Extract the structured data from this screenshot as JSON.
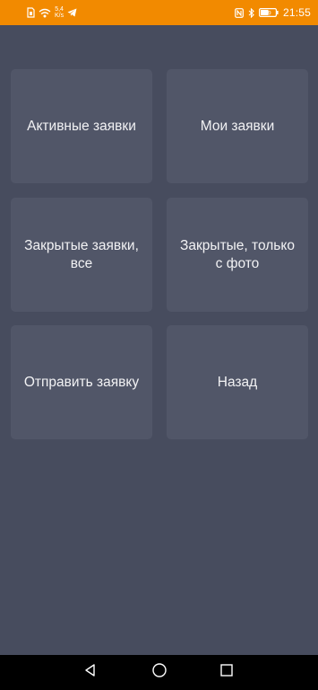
{
  "status_bar": {
    "speed_value": "5,4",
    "speed_unit": "K/s",
    "time": "21:55",
    "battery_level": "49",
    "icons": [
      "sim-card-icon",
      "wifi-icon",
      "telegram-icon",
      "nfc-icon",
      "bluetooth-icon",
      "battery-icon"
    ]
  },
  "menu": {
    "tiles": [
      {
        "label": "Активные заявки"
      },
      {
        "label": "Мои заявки"
      },
      {
        "label": "Закрытые заявки, все"
      },
      {
        "label": "Закрытые, только с фото"
      },
      {
        "label": "Отправить заявку"
      },
      {
        "label": "Назад"
      }
    ]
  },
  "nav_bar": {
    "icons": [
      "back-icon",
      "home-icon",
      "recents-icon"
    ]
  },
  "colors": {
    "status_bar": "#f28a00",
    "background": "#474c5e",
    "tile": "#515668",
    "tile_text": "#f2f2f4",
    "nav_bar": "#000000"
  }
}
